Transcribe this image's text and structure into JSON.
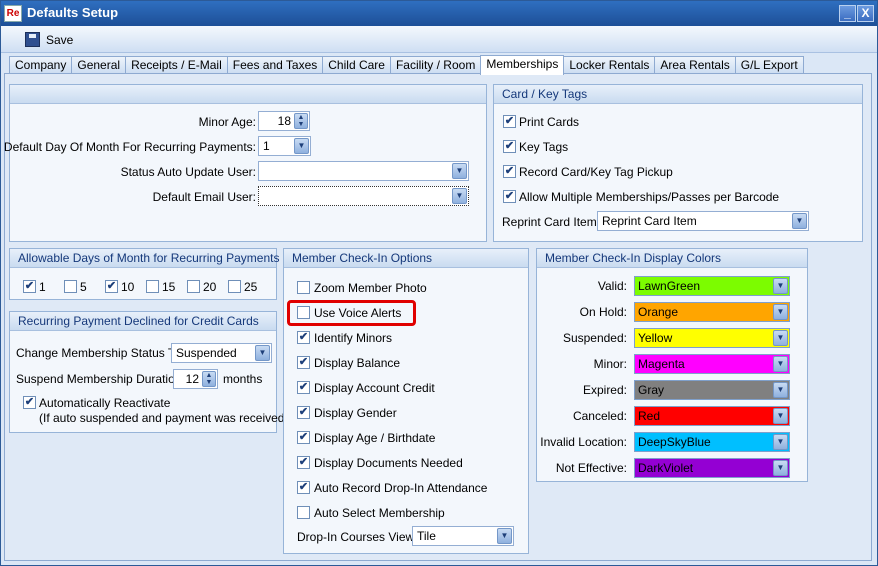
{
  "window": {
    "title": "Defaults Setup",
    "icon_text": "Re",
    "minimize": "_",
    "close": "X"
  },
  "toolbar": {
    "save_label": "Save"
  },
  "tabs": [
    "Company",
    "General",
    "Receipts / E-Mail",
    "Fees and Taxes",
    "Child Care",
    "Facility / Room",
    "Memberships",
    "Locker Rentals",
    "Area Rentals",
    "G/L Export"
  ],
  "active_tab": "Memberships",
  "general": {
    "minor_age_label": "Minor Age:",
    "minor_age": "18",
    "default_day_label": "Default Day Of Month For Recurring Payments:",
    "default_day": "1",
    "status_user_label": "Status Auto Update User:",
    "status_user": "",
    "email_user_label": "Default Email User:",
    "email_user": ""
  },
  "card_tags": {
    "title": "Card / Key Tags",
    "print_cards": "Print Cards",
    "key_tags": "Key Tags",
    "record_pickup": "Record Card/Key Tag Pickup",
    "allow_multiple": "Allow Multiple Memberships/Passes per Barcode",
    "reprint_label": "Reprint Card Item:",
    "reprint_value": "Reprint Card Item"
  },
  "allowable_days": {
    "title": "Allowable Days of Month for Recurring Payments",
    "days": [
      {
        "label": "1",
        "checked": true
      },
      {
        "label": "5",
        "checked": false
      },
      {
        "label": "10",
        "checked": true
      },
      {
        "label": "15",
        "checked": false
      },
      {
        "label": "20",
        "checked": false
      },
      {
        "label": "25",
        "checked": false
      }
    ]
  },
  "declined": {
    "title": "Recurring Payment Declined for Credit Cards",
    "change_status_label": "Change Membership Status To:",
    "change_status_value": "Suspended",
    "suspend_duration_label": "Suspend Membership Duration:",
    "suspend_duration_value": "12",
    "suspend_duration_unit": "months",
    "auto_reactivate": "Automatically Reactivate",
    "auto_reactivate_note": "(If auto suspended and payment was received)"
  },
  "checkin_options": {
    "title": "Member Check-In Options",
    "items": [
      {
        "label": "Zoom Member Photo",
        "checked": false
      },
      {
        "label": "Use Voice Alerts",
        "checked": false
      },
      {
        "label": "Identify Minors",
        "checked": true
      },
      {
        "label": "Display Balance",
        "checked": true
      },
      {
        "label": "Display Account Credit",
        "checked": true
      },
      {
        "label": "Display Gender",
        "checked": true
      },
      {
        "label": "Display Age / Birthdate",
        "checked": true
      },
      {
        "label": "Display Documents Needed",
        "checked": true
      },
      {
        "label": "Auto Record Drop-In Attendance",
        "checked": true
      },
      {
        "label": "Auto Select Membership",
        "checked": false
      }
    ],
    "dropin_label": "Drop-In Courses View:",
    "dropin_value": "Tile"
  },
  "display_colors": {
    "title": "Member Check-In Display Colors",
    "items": [
      {
        "label": "Valid:",
        "value": "LawnGreen",
        "color": "#7CFC00",
        "text": "#000000"
      },
      {
        "label": "On Hold:",
        "value": "Orange",
        "color": "#FFA500",
        "text": "#000000"
      },
      {
        "label": "Suspended:",
        "value": "Yellow",
        "color": "#FFFF00",
        "text": "#000000"
      },
      {
        "label": "Minor:",
        "value": "Magenta",
        "color": "#FF00FF",
        "text": "#000000"
      },
      {
        "label": "Expired:",
        "value": "Gray",
        "color": "#808080",
        "text": "#000000"
      },
      {
        "label": "Canceled:",
        "value": "Red",
        "color": "#FF0000",
        "text": "#000000"
      },
      {
        "label": "Invalid Location:",
        "value": "DeepSkyBlue",
        "color": "#00BFFF",
        "text": "#000000"
      },
      {
        "label": "Not Effective:",
        "value": "DarkViolet",
        "color": "#9400D3",
        "text": "#000000"
      }
    ]
  }
}
